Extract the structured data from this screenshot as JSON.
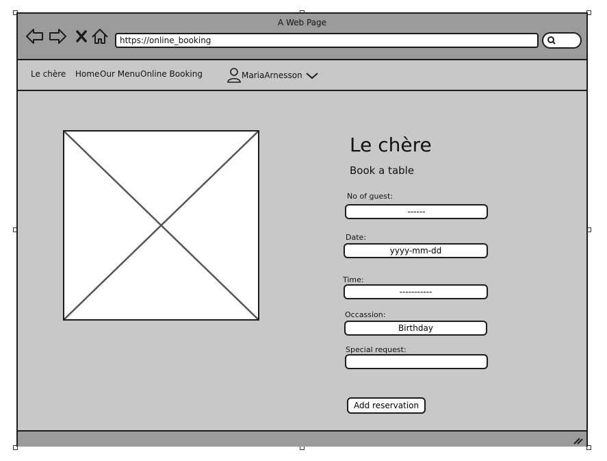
{
  "window": {
    "title": "A Web Page"
  },
  "browser": {
    "url": "https://online_booking",
    "icons": [
      "back-arrow-icon",
      "forward-arrow-icon",
      "close-x-icon",
      "home-icon",
      "search-icon"
    ]
  },
  "nav": {
    "brand": "Le chère",
    "items": [
      {
        "label": "Home"
      },
      {
        "label": "Our Menu"
      },
      {
        "label": "Online Booking"
      }
    ],
    "user": {
      "name": "MariaArnesson",
      "icon": "user-icon",
      "chevron": "chevron-down-icon"
    }
  },
  "page": {
    "title": "Le chère",
    "subtitle": "Book a table",
    "image_placeholder": "image-placeholder-icon"
  },
  "form": {
    "guests": {
      "label": "No of guest:",
      "value": "------"
    },
    "date": {
      "label": "Date:",
      "value": "yyyy-mm-dd"
    },
    "time": {
      "label": "Time:",
      "value": "-----------"
    },
    "occasion": {
      "label": "Occassion:",
      "value": "Birthday"
    },
    "request": {
      "label": "Special request:",
      "value": ""
    },
    "submit_label": "Add reservation"
  },
  "colors": {
    "chrome": "#9b9b9b",
    "content": "#c8c8c8",
    "border": "#1b1b1b"
  }
}
